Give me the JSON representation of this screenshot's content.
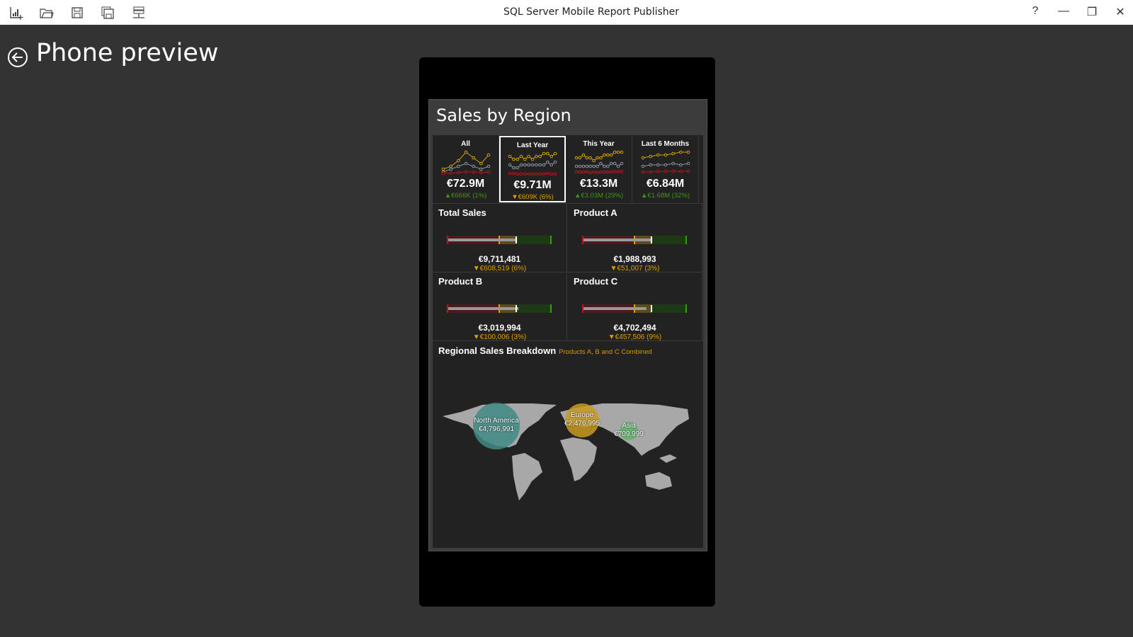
{
  "app": {
    "title": "SQL Server Mobile Report Publisher",
    "toolbar": [
      "new-report-icon",
      "open-folder-icon",
      "save-icon",
      "save-as-icon",
      "server-icon"
    ],
    "help": "?",
    "minimize": "—",
    "restore": "❐",
    "close": "✕"
  },
  "page": {
    "title": "Phone preview"
  },
  "report": {
    "title": "Sales by Region",
    "tiles": [
      {
        "label": "All",
        "value": "€72.9M",
        "delta": "▲€666K (1%)",
        "trend": "up",
        "selected": false,
        "series": [
          [
            2,
            3,
            5,
            8,
            6,
            4,
            7
          ],
          [
            1,
            2,
            3,
            4,
            3,
            2,
            3
          ],
          [
            0.5,
            0.6,
            0.8,
            1,
            1,
            0.8,
            1
          ]
        ]
      },
      {
        "label": "Last Year",
        "value": "€9.71M",
        "delta": "▼€609K (6%)",
        "trend": "down",
        "selected": true,
        "series": [
          [
            7,
            6,
            6,
            7,
            6,
            7,
            6,
            7,
            7,
            8,
            8,
            7,
            8
          ],
          [
            4,
            3,
            3,
            4,
            4,
            4,
            4,
            4,
            4,
            4,
            5,
            4,
            5
          ],
          [
            1,
            1,
            0.8,
            0.8,
            0.8,
            0.8,
            0.8,
            0.8,
            0.8,
            0.8,
            1,
            0.8,
            0.8
          ]
        ]
      },
      {
        "label": "This Year",
        "value": "€13.3M",
        "delta": "▲€3.03M (29%)",
        "trend": "up",
        "selected": false,
        "series": [
          [
            6,
            6,
            7,
            6,
            6,
            5,
            6,
            6,
            7,
            7,
            7,
            8,
            8,
            8
          ],
          [
            3,
            3,
            3,
            3,
            3,
            3,
            3,
            4,
            3,
            3,
            4,
            4,
            3,
            4
          ],
          [
            1,
            1,
            1,
            1,
            0.8,
            1,
            0.8,
            1,
            1,
            1,
            1,
            1.1,
            1.1,
            1.1
          ]
        ]
      },
      {
        "label": "Last 6 Months",
        "value": "€6.84M",
        "delta": "▲€1.68M (32%)",
        "trend": "up",
        "selected": false,
        "series": [
          [
            6,
            6.5,
            7,
            7,
            7.5,
            8,
            8
          ],
          [
            3,
            3.5,
            3.5,
            3.5,
            4,
            3.5,
            4
          ],
          [
            1,
            1,
            1.2,
            1.2,
            1.3,
            1.2,
            1.3
          ]
        ]
      }
    ],
    "gauges": [
      {
        "title": "Total Sales",
        "value": "€9,711,481",
        "delta": "▼€608,519 (6%)",
        "fill_pct": 0.65
      },
      {
        "title": "Product A",
        "value": "€1,988,993",
        "delta": "▼€51,007 (3%)",
        "fill_pct": 0.65
      },
      {
        "title": "Product B",
        "value": "€3,019,994",
        "delta": "▼€100,006 (3%)",
        "fill_pct": 0.67
      },
      {
        "title": "Product C",
        "value": "€4,702,494",
        "delta": "▼€457,506 (9%)",
        "fill_pct": 0.6
      }
    ],
    "map": {
      "title": "Regional Sales Breakdown",
      "subtitle": "Products A, B and C Combined",
      "regions": [
        {
          "name": "North America",
          "value": "€4,796,991",
          "color": "#3f8a84"
        },
        {
          "name": "Europe",
          "value": "€2,476,995",
          "color": "#c99a20"
        },
        {
          "name": "Asia",
          "value": "€709,999",
          "color": "#5fb56a"
        }
      ]
    },
    "colors": {
      "good": "#3a9a10",
      "warn": "#e0a000",
      "bad": "#c0141c",
      "neutral": "#8a95a0"
    }
  }
}
